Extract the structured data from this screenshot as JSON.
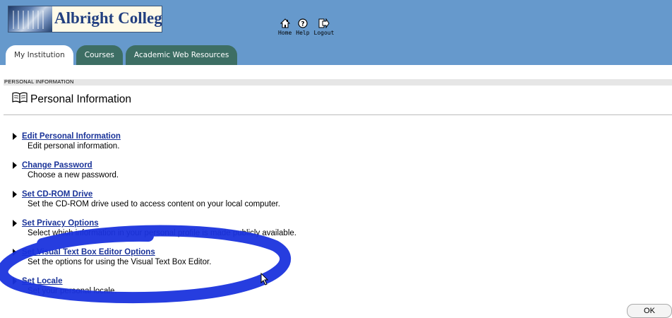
{
  "header": {
    "logo_text": "Albright College",
    "nav": [
      {
        "label": "Home",
        "icon": "home-icon"
      },
      {
        "label": "Help",
        "icon": "help-icon"
      },
      {
        "label": "Logout",
        "icon": "logout-icon"
      }
    ]
  },
  "tabs": [
    {
      "label": "My Institution",
      "active": true
    },
    {
      "label": "Courses",
      "active": false
    },
    {
      "label": "Academic Web Resources",
      "active": false
    }
  ],
  "breadcrumb": "PERSONAL INFORMATION",
  "page_title": "Personal Information",
  "tasks": [
    {
      "link": "Edit Personal Information",
      "desc": "Edit personal information."
    },
    {
      "link": "Change Password",
      "desc": "Choose a new password."
    },
    {
      "link": "Set CD-ROM Drive",
      "desc": "Set the CD-ROM drive used to access content on your local computer."
    },
    {
      "link": "Set Privacy Options",
      "desc": "Select which information in your personal profile is made publicly available."
    },
    {
      "link": "Set Visual Text Box Editor Options",
      "desc": "Set the options for using the Visual Text Box Editor."
    },
    {
      "link": "Set Locale",
      "desc": "Set your personal locale."
    }
  ],
  "ok_label": "OK",
  "colors": {
    "header_bg": "#6699cc",
    "tab_inactive": "#3d6e64",
    "link": "#1a3399",
    "annotation_ellipse": "#1a33dd"
  }
}
